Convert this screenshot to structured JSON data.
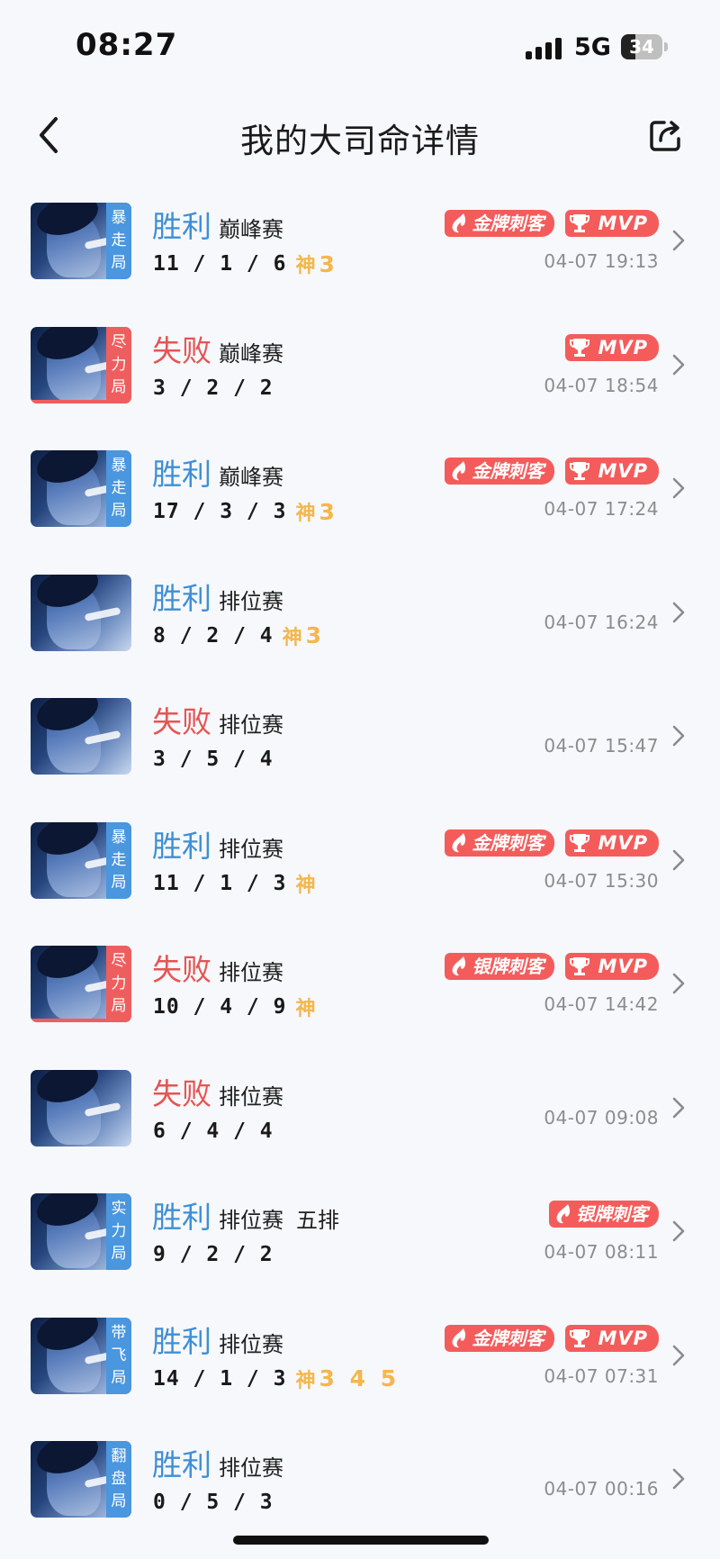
{
  "status_bar": {
    "time": "08:27",
    "network": "5G",
    "battery": "34",
    "battery_level": 0.34
  },
  "nav": {
    "title": "我的大司命详情"
  },
  "matches": [
    {
      "tag": "暴\n走\n局",
      "tag_color": "blue",
      "result": "胜利",
      "outcome": "win",
      "mode": "巅峰赛",
      "mode_extra": "",
      "kda": "11 / 1 / 6",
      "god": "神",
      "streaks": "3",
      "badges": [
        "金牌刺客",
        "MVP"
      ],
      "time": "04-07 19:13"
    },
    {
      "tag": "尽\n力\n局",
      "tag_color": "red",
      "result": "失败",
      "outcome": "loss",
      "mode": "巅峰赛",
      "mode_extra": "",
      "kda": "3 / 2 / 2",
      "god": "",
      "streaks": "",
      "badges": [
        "MVP"
      ],
      "time": "04-07 18:54"
    },
    {
      "tag": "暴\n走\n局",
      "tag_color": "blue",
      "result": "胜利",
      "outcome": "win",
      "mode": "巅峰赛",
      "mode_extra": "",
      "kda": "17 / 3 / 3",
      "god": "神",
      "streaks": "3",
      "badges": [
        "金牌刺客",
        "MVP"
      ],
      "time": "04-07 17:24"
    },
    {
      "tag": "",
      "tag_color": "",
      "result": "胜利",
      "outcome": "win",
      "mode": "排位赛",
      "mode_extra": "",
      "kda": "8 / 2 / 4",
      "god": "神",
      "streaks": "3",
      "badges": [],
      "time": "04-07 16:24"
    },
    {
      "tag": "",
      "tag_color": "",
      "result": "失败",
      "outcome": "loss",
      "mode": "排位赛",
      "mode_extra": "",
      "kda": "3 / 5 / 4",
      "god": "",
      "streaks": "",
      "badges": [],
      "time": "04-07 15:47"
    },
    {
      "tag": "暴\n走\n局",
      "tag_color": "blue",
      "result": "胜利",
      "outcome": "win",
      "mode": "排位赛",
      "mode_extra": "",
      "kda": "11 / 1 / 3",
      "god": "神",
      "streaks": "",
      "badges": [
        "金牌刺客",
        "MVP"
      ],
      "time": "04-07 15:30"
    },
    {
      "tag": "尽\n力\n局",
      "tag_color": "red",
      "result": "失败",
      "outcome": "loss",
      "mode": "排位赛",
      "mode_extra": "",
      "kda": "10 / 4 / 9",
      "god": "神",
      "streaks": "",
      "badges": [
        "银牌刺客",
        "MVP"
      ],
      "time": "04-07 14:42"
    },
    {
      "tag": "",
      "tag_color": "",
      "result": "失败",
      "outcome": "loss",
      "mode": "排位赛",
      "mode_extra": "",
      "kda": "6 / 4 / 4",
      "god": "",
      "streaks": "",
      "badges": [],
      "time": "04-07 09:08"
    },
    {
      "tag": "实\n力\n局",
      "tag_color": "blue",
      "result": "胜利",
      "outcome": "win",
      "mode": "排位赛",
      "mode_extra": "五排",
      "kda": "9 / 2 / 2",
      "god": "",
      "streaks": "",
      "badges": [
        "银牌刺客"
      ],
      "time": "04-07 08:11"
    },
    {
      "tag": "带\n飞\n局",
      "tag_color": "blue",
      "result": "胜利",
      "outcome": "win",
      "mode": "排位赛",
      "mode_extra": "",
      "kda": "14 / 1 / 3",
      "god": "神",
      "streaks": "3 4 5",
      "badges": [
        "金牌刺客",
        "MVP"
      ],
      "time": "04-07 07:31"
    },
    {
      "tag": "翻\n盘\n局",
      "tag_color": "blue",
      "result": "胜利",
      "outcome": "win",
      "mode": "排位赛",
      "mode_extra": "",
      "kda": "0 / 5 / 3",
      "god": "",
      "streaks": "",
      "badges": [],
      "time": "04-07 00:16"
    }
  ]
}
